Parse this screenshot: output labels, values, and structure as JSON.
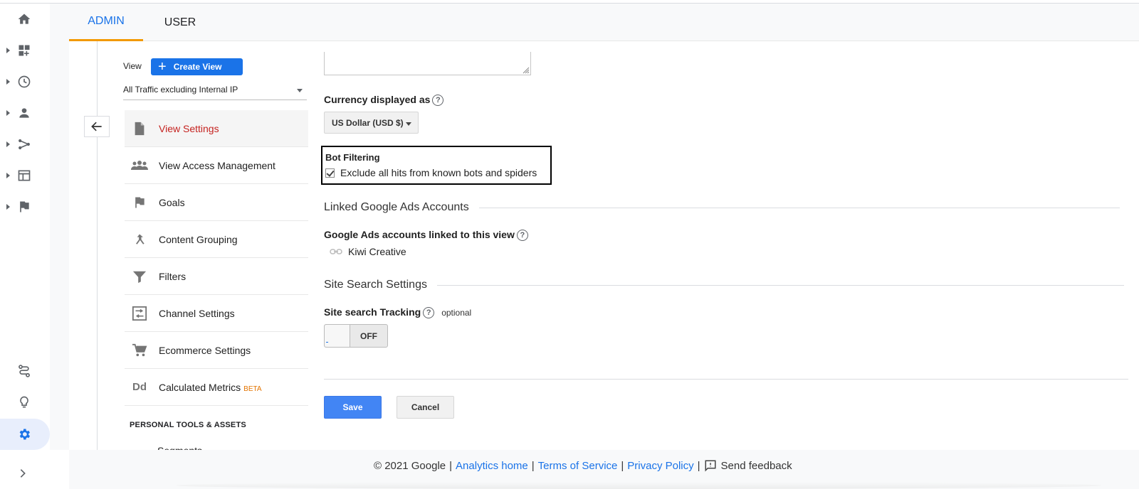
{
  "tabs": {
    "admin": "ADMIN",
    "user": "USER"
  },
  "left_rail": {
    "items": [
      "home-icon",
      "dashboard-icon",
      "clock-icon",
      "person-icon",
      "flow-icon",
      "layout-icon",
      "flag-icon"
    ],
    "bottom": [
      "route-icon",
      "lightbulb-icon",
      "gear-icon"
    ],
    "expand": "chevron-right-icon"
  },
  "view_panel": {
    "view_label": "View",
    "create_view_label": "Create View",
    "selected_view": "All Traffic excluding Internal IP",
    "nav_items": [
      {
        "label": "View Settings",
        "icon": "document-icon",
        "active": true
      },
      {
        "label": "View Access Management",
        "icon": "people-icon"
      },
      {
        "label": "Goals",
        "icon": "flag-icon"
      },
      {
        "label": "Content Grouping",
        "icon": "merge-icon"
      },
      {
        "label": "Filters",
        "icon": "filter-icon"
      },
      {
        "label": "Channel Settings",
        "icon": "channel-icon"
      },
      {
        "label": "Ecommerce Settings",
        "icon": "cart-icon"
      },
      {
        "label": "Calculated Metrics",
        "icon": "dd-icon",
        "badge": "BETA"
      }
    ],
    "section_header": "PERSONAL TOOLS & ASSETS",
    "cut_item": "Segments"
  },
  "form": {
    "currency_label": "Currency displayed as",
    "currency_value": "US Dollar (USD $)",
    "bot_filtering_title": "Bot Filtering",
    "bot_filtering_option": "Exclude all hits from known bots and spiders",
    "linked_ads_section": "Linked Google Ads Accounts",
    "linked_ads_label": "Google Ads accounts linked to this view",
    "linked_account": "Kiwi Creative",
    "site_search_section": "Site Search Settings",
    "site_search_label": "Site search Tracking",
    "optional": "optional",
    "toggle_state": "OFF",
    "save": "Save",
    "cancel": "Cancel"
  },
  "footer": {
    "copyright": "© 2021 Google",
    "analytics_home": "Analytics home",
    "terms": "Terms of Service",
    "privacy": "Privacy Policy",
    "feedback": "Send feedback"
  },
  "colors": {
    "accent": "#1a73e8",
    "active_nav": "#c5221f",
    "tab_underline": "#f29900",
    "save_button": "#4285f4"
  }
}
